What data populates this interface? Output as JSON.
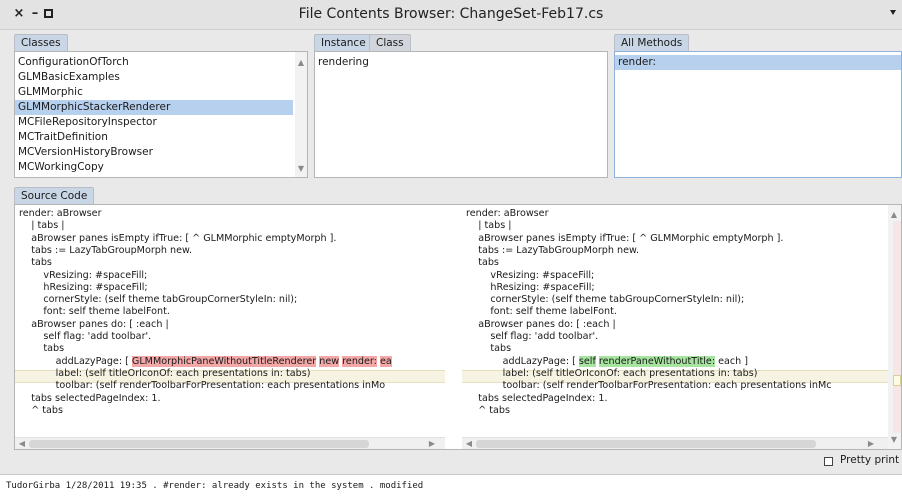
{
  "window": {
    "title": "File Contents Browser: ChangeSet-Feb17.cs",
    "close_glyph": "×",
    "min_glyph": "–"
  },
  "classes": {
    "tab_label": "Classes",
    "items": [
      "ConfigurationOfTorch",
      "GLMBasicExamples",
      "GLMMorphic",
      "GLMMorphicStackerRenderer",
      "MCFileRepositoryInspector",
      "MCTraitDefinition",
      "MCVersionHistoryBrowser",
      "MCWorkingCopy"
    ],
    "selected_index": 3
  },
  "categories": {
    "tab_instance": "Instance",
    "tab_class": "Class",
    "items": [
      "rendering"
    ]
  },
  "methods": {
    "tab_label": "All Methods",
    "items": [
      "render:"
    ],
    "selected_index": 0
  },
  "source": {
    "tab_label": "Source Code",
    "left_lines": [
      "render: aBrowser",
      "    | tabs |",
      "    aBrowser panes isEmpty ifTrue: [ ^ GLMMorphic emptyMorph ].",
      "    tabs := LazyTabGroupMorph new.",
      "    tabs",
      "        vResizing: #spaceFill;",
      "        hResizing: #spaceFill;",
      "        cornerStyle: (self theme tabGroupCornerStyleIn: nil);",
      "        font: self theme labelFont.",
      "    aBrowser panes do: [ :each |",
      "        self flag: 'add toolbar'.",
      "        tabs"
    ],
    "left_changed_prefix": "            addLazyPage: [ ",
    "left_changed_del1": "GLMMorphicPaneWithoutTitleRenderer",
    "left_changed_del2": "new",
    "left_changed_del3": "render:",
    "left_changed_del4": "ea",
    "left_tail_lines": [
      "            label: (self titleOrIconOf: each presentations in: tabs)",
      "            toolbar: (self renderToolbarForPresentation: each presentations inMo",
      "    tabs selectedPageIndex: 1.",
      "    ^ tabs"
    ],
    "right_lines": [
      "render: aBrowser",
      "    | tabs |",
      "    aBrowser panes isEmpty ifTrue: [ ^ GLMMorphic emptyMorph ].",
      "    tabs := LazyTabGroupMorph new.",
      "    tabs",
      "        vResizing: #spaceFill;",
      "        hResizing: #spaceFill;",
      "        cornerStyle: (self theme tabGroupCornerStyleIn: nil);",
      "        font: self theme labelFont.",
      "    aBrowser panes do: [ :each |",
      "        self flag: 'add toolbar'.",
      "        tabs"
    ],
    "right_changed_prefix": "            addLazyPage: [ ",
    "right_changed_ins1": "self",
    "right_changed_ins2": "renderPaneWithoutTitle:",
    "right_changed_suffix": " each ]",
    "right_tail_lines": [
      "            label: (self titleOrIconOf: each presentations in: tabs)",
      "            toolbar: (self renderToolbarForPresentation: each presentations inMc",
      "    tabs selectedPageIndex: 1.",
      "    ^ tabs"
    ],
    "pretty_print_label": "Pretty print"
  },
  "status": {
    "text": "TudorGirba 1/28/2011 19:35 . #render: already exists in the system . modified"
  },
  "colors": {
    "selection": "#b7d0ee",
    "deleted": "#f3a7a7",
    "inserted": "#a6e4a0",
    "changed_line": "#f7f3e3"
  },
  "icons": {
    "scroll_up": "▲",
    "scroll_down": "▼",
    "scroll_left": "◀",
    "scroll_right": "▶"
  }
}
